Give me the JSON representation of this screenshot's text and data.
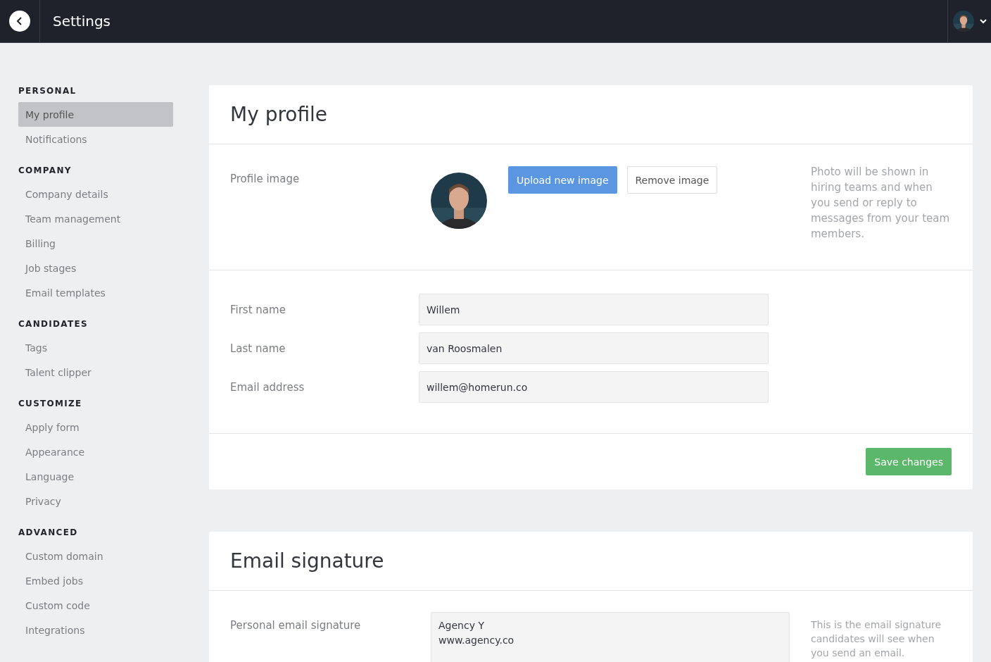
{
  "topbar": {
    "title": "Settings"
  },
  "sidebar": {
    "sections": [
      {
        "heading": "PERSONAL",
        "items": [
          {
            "label": "My profile",
            "selected": true
          },
          {
            "label": "Notifications",
            "selected": false
          }
        ]
      },
      {
        "heading": "COMPANY",
        "items": [
          {
            "label": "Company details",
            "selected": false
          },
          {
            "label": "Team management",
            "selected": false
          },
          {
            "label": "Billing",
            "selected": false
          },
          {
            "label": "Job stages",
            "selected": false
          },
          {
            "label": "Email templates",
            "selected": false
          }
        ]
      },
      {
        "heading": "CANDIDATES",
        "items": [
          {
            "label": "Tags",
            "selected": false
          },
          {
            "label": "Talent clipper",
            "selected": false
          }
        ]
      },
      {
        "heading": "CUSTOMIZE",
        "items": [
          {
            "label": "Apply form",
            "selected": false
          },
          {
            "label": "Appearance",
            "selected": false
          },
          {
            "label": "Language",
            "selected": false
          },
          {
            "label": "Privacy",
            "selected": false
          }
        ]
      },
      {
        "heading": "ADVANCED",
        "items": [
          {
            "label": "Custom domain",
            "selected": false
          },
          {
            "label": "Embed jobs",
            "selected": false
          },
          {
            "label": "Custom code",
            "selected": false
          },
          {
            "label": "Integrations",
            "selected": false
          }
        ]
      }
    ]
  },
  "profile": {
    "title": "My profile",
    "image_label": "Profile image",
    "upload_button": "Upload new image",
    "remove_button": "Remove image",
    "image_hint": "Photo will be shown in hiring teams and when you send or reply to messages from your team members.",
    "fields": [
      {
        "label": "First name",
        "value": "Willem"
      },
      {
        "label": "Last name",
        "value": "van Roosmalen"
      },
      {
        "label": "Email address",
        "value": "willem@homerun.co"
      }
    ],
    "save_button": "Save changes"
  },
  "signature": {
    "title": "Email signature",
    "label": "Personal email signature",
    "value": "Agency Y\nwww.agency.co",
    "hint": "This is the email signature candidates will see when you send an email."
  }
}
